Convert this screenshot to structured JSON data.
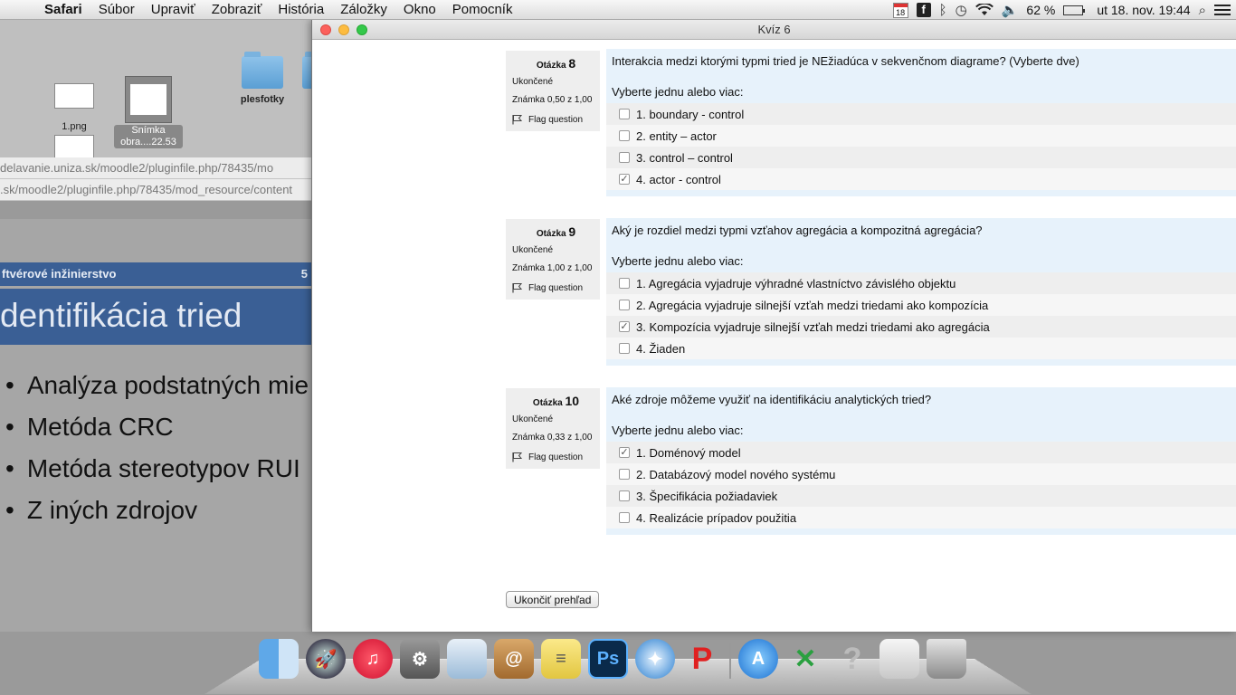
{
  "menubar": {
    "app": "Safari",
    "menus": [
      "Súbor",
      "Upraviť",
      "Zobraziť",
      "História",
      "Záložky",
      "Okno",
      "Pomocník"
    ],
    "calendar_day": "18",
    "battery": "62 %",
    "clock": "ut 18. nov.  19:44"
  },
  "desktop": {
    "icon1_label": "1.png",
    "icon2_label": "Snímka obra....22.53",
    "folder_label": "plesfotky",
    "url1": "delavanie.uniza.sk/moodle2/pluginfile.php/78435/mo",
    "url2": ".sk/moodle2/pluginfile.php/78435/mod_resource/content"
  },
  "slide": {
    "header": "ftvérové inžinierstvo",
    "page": "5",
    "title": "dentifikácia tried",
    "bullets": [
      "Analýza podstatných mie",
      "Metóda CRC",
      "Metóda stereotypov RUI",
      "Z iných zdrojov"
    ]
  },
  "window": {
    "title": "Kvíz 6",
    "finish_button": "Ukončiť prehľad"
  },
  "questions": [
    {
      "label": "Otázka",
      "number": "8",
      "state": "Ukončené",
      "grade": "Známka 0,50 z 1,00",
      "flag": "Flag question",
      "text": "Interakcia medzi ktorými typmi tried je NEžiadúca v sekvenčnom diagrame? (Vyberte dve)",
      "prompt": "Vyberte jednu alebo viac:",
      "options": [
        {
          "text": "1. boundary - control",
          "mark": ""
        },
        {
          "text": "2. entity – actor",
          "mark": ""
        },
        {
          "text": "3. control – control",
          "mark": ""
        },
        {
          "text": "4. actor - control",
          "mark": "✓"
        }
      ]
    },
    {
      "label": "Otázka",
      "number": "9",
      "state": "Ukončené",
      "grade": "Známka 1,00 z 1,00",
      "flag": "Flag question",
      "text": "Aký je rozdiel medzi typmi vzťahov agregácia a kompozitná agregácia?",
      "prompt": "Vyberte jednu alebo viac:",
      "options": [
        {
          "text": "1. Agregácia vyjadruje výhradné vlastníctvo závislého objektu",
          "mark": ""
        },
        {
          "text": "2. Agregácia vyjadruje silnejší vzťah medzi triedami ako kompozícia",
          "mark": ""
        },
        {
          "text": "3. Kompozícia vyjadruje silnejší vzťah medzi triedami ako agregácia",
          "mark": "✓"
        },
        {
          "text": "4. Žiaden",
          "mark": ""
        }
      ]
    },
    {
      "label": "Otázka",
      "number": "10",
      "state": "Ukončené",
      "grade": "Známka 0,33 z 1,00",
      "flag": "Flag question",
      "text": "Aké zdroje môžeme využiť na identifikáciu analytických tried?",
      "prompt": "Vyberte jednu alebo viac:",
      "options": [
        {
          "text": "1. Doménový model",
          "mark": "✓"
        },
        {
          "text": "2. Databázový model nového systému",
          "mark": ""
        },
        {
          "text": "3. Špecifikácia požiadaviek",
          "mark": ""
        },
        {
          "text": "4. Realizácie prípadov použitia",
          "mark": ""
        }
      ]
    }
  ],
  "dock": {
    "apps": [
      "finder-icon",
      "launchpad-icon",
      "itunes-icon",
      "system-preferences-icon",
      "preview-icon",
      "contacts-icon",
      "notes-icon",
      "photoshop-icon",
      "safari-icon",
      "pages-icon",
      "app-store-icon",
      "crossover-icon",
      "unknown-app-icon",
      "screenshot-icon",
      "trash-icon"
    ],
    "photoshop_label": "Ps"
  }
}
